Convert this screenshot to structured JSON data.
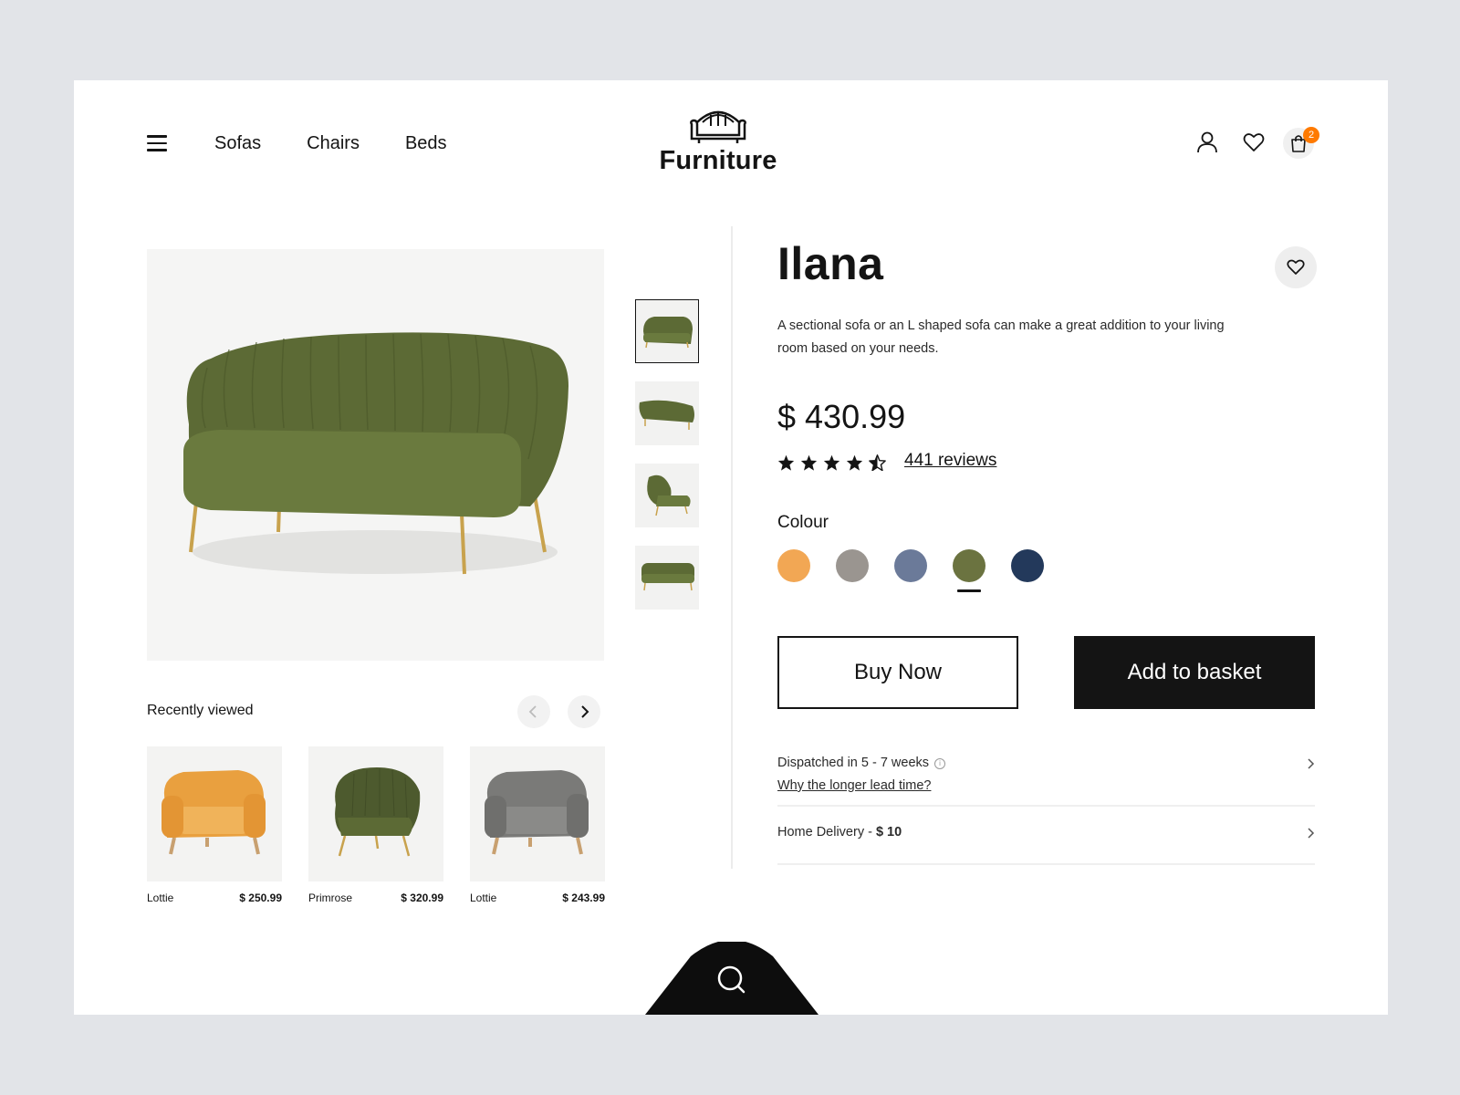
{
  "header": {
    "nav": [
      "Sofas",
      "Chairs",
      "Beds"
    ],
    "logo_text": "Furniture",
    "cart_count": "2"
  },
  "product": {
    "name": "Ilana",
    "description": "A sectional sofa or an L shaped sofa can make a great addition to your living room based on your needs.",
    "price": "$ 430.99",
    "rating": 4.5,
    "reviews": "441 reviews",
    "colour_label": "Colour",
    "colours": [
      "#f2a754",
      "#9a9590",
      "#6b7a99",
      "#6b7340",
      "#23395b"
    ],
    "selected_colour_index": 3,
    "buy_now": "Buy Now",
    "add_to_basket": "Add to basket",
    "dispatch": "Dispatched in 5 - 7 weeks",
    "lead_time_link": "Why the longer lead time?",
    "delivery_label": "Home Delivery - ",
    "delivery_price": "$ 10"
  },
  "recently_viewed": {
    "title": "Recently viewed",
    "items": [
      {
        "name": "Lottie",
        "price": "$ 250.99",
        "color": "#e9a03f"
      },
      {
        "name": "Primrose",
        "price": "$ 320.99",
        "color": "#4d5a2e"
      },
      {
        "name": "Lottie",
        "price": "$ 243.99",
        "color": "#7a7a78"
      }
    ]
  },
  "colors": {
    "accent": "#ff7a00",
    "sofa": "#5c6a35",
    "dark": "#141414"
  }
}
